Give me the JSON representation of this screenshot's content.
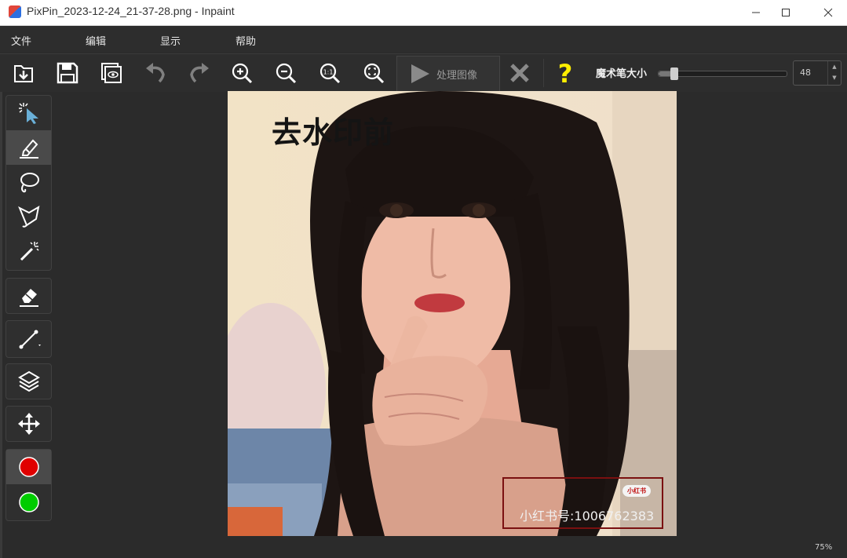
{
  "window": {
    "title": "PixPin_2023-12-24_21-37-28.png - Inpaint",
    "icon": "app-icon",
    "controls": [
      "minimize-icon",
      "maximize-icon",
      "close-icon"
    ]
  },
  "menu": {
    "items": [
      "文件",
      "编辑",
      "显示",
      "帮助"
    ]
  },
  "toolbar": {
    "buttons": [
      {
        "name": "open-icon"
      },
      {
        "name": "save-icon"
      },
      {
        "name": "preview-icon"
      },
      {
        "name": "undo-icon"
      },
      {
        "name": "redo-icon"
      },
      {
        "name": "zoom-in-icon"
      },
      {
        "name": "zoom-out-icon"
      },
      {
        "name": "zoom-actual-icon"
      },
      {
        "name": "zoom-fit-icon"
      }
    ],
    "process_label": "处理图像",
    "cancel_icon": "cancel-x-icon",
    "help_icon": "help-question-icon",
    "brush_size_label": "魔术笔大小",
    "brush_size_value": "48",
    "brush_size_fraction": 0.12
  },
  "sidebar": {
    "tools": [
      {
        "name": "smart-select-icon"
      },
      {
        "name": "marker-icon",
        "selected": true
      },
      {
        "name": "lasso-icon"
      },
      {
        "name": "polygon-lasso-icon"
      },
      {
        "name": "magic-wand-icon"
      },
      {
        "name": "eraser-icon"
      },
      {
        "name": "line-tool-icon"
      },
      {
        "name": "layers-icon"
      },
      {
        "name": "move-icon"
      },
      {
        "name": "red-color-icon"
      },
      {
        "name": "green-color-icon"
      }
    ]
  },
  "canvas": {
    "overlay_title": "去水印前",
    "watermark_logo": "小红书",
    "watermark_text": "小红书号:1006762383"
  },
  "status": {
    "zoom": "75%"
  },
  "colors": {
    "background": "#2b2b2b",
    "help": "#ffee00",
    "red_swatch": "#e00000",
    "green_swatch": "#00cc00",
    "watermark_border": "#7a1010"
  }
}
